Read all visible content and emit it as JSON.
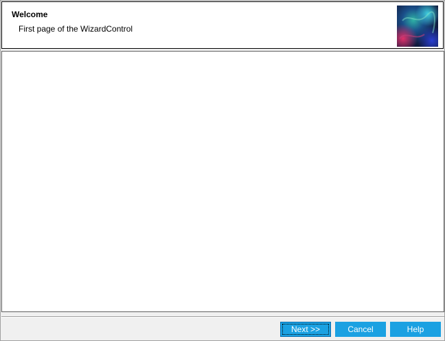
{
  "wizard": {
    "header": {
      "title": "Welcome",
      "description": "First page of the WizardControl",
      "image_icon": "abstract-header-image"
    },
    "buttons": {
      "next_label": "Next >>",
      "cancel_label": "Cancel",
      "help_label": "Help"
    },
    "colors": {
      "button_bg": "#1ba1e2",
      "button_text": "#ffffff",
      "content_bg": "#ffffff",
      "dialog_bg": "#f0f0f0"
    }
  }
}
